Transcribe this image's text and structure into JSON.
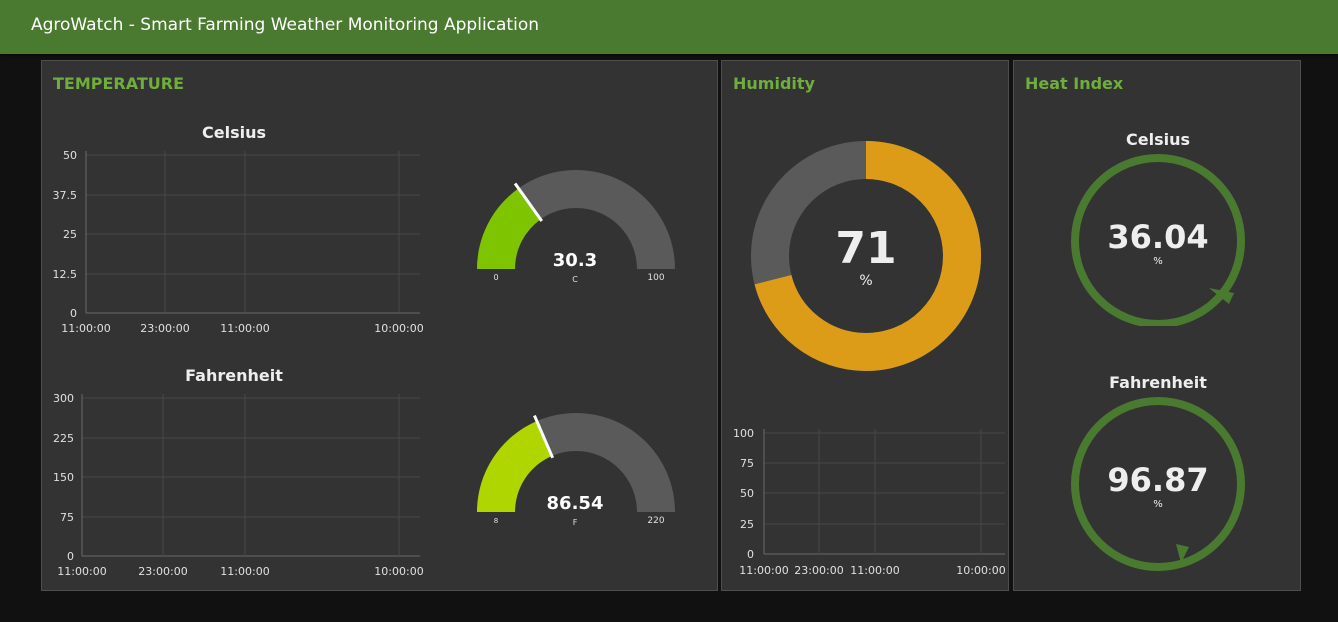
{
  "app": {
    "title": "AgroWatch - Smart Farming Weather Monitoring Application",
    "accent_color": "#4a7a2f"
  },
  "temperature": {
    "title": "TEMPERATURE",
    "celsius_chart": {
      "title": "Celsius",
      "y_ticks": [
        "50",
        "37.5",
        "25",
        "12.5",
        "0"
      ],
      "x_ticks": [
        "11:00:00",
        "23:00:00",
        "11:00:00",
        "10:00:00"
      ]
    },
    "fahrenheit_chart": {
      "title": "Fahrenheit",
      "y_ticks": [
        "300",
        "225",
        "150",
        "75",
        "0"
      ],
      "x_ticks": [
        "11:00:00",
        "23:00:00",
        "11:00:00",
        "10:00:00"
      ]
    },
    "celsius_gauge": {
      "value": 30.3,
      "value_text": "30.3",
      "unit": "C",
      "min": 0,
      "max": 100,
      "min_label": "0",
      "max_label": "100",
      "fill_color": "#7ec400"
    },
    "fahrenheit_gauge": {
      "value": 86.54,
      "value_text": "86.54",
      "unit": "F",
      "min": 8,
      "max": 220,
      "min_label": "8",
      "max_label": "220",
      "fill_color": "#b0d600"
    }
  },
  "humidity": {
    "title": "Humidity",
    "donut": {
      "value": 71,
      "value_text": "71",
      "unit": "%",
      "fill_color": "#dc9c17",
      "track_color": "#5a5a5a"
    },
    "chart": {
      "y_ticks": [
        "100",
        "75",
        "50",
        "25",
        "0"
      ],
      "x_ticks": [
        "11:00:00",
        "23:00:00",
        "11:00:00",
        "10:00:00"
      ]
    }
  },
  "heat_index": {
    "title": "Heat Index",
    "celsius": {
      "title": "Celsius",
      "value_text": "36.04",
      "unit": "%",
      "ring_color": "#4a7a2f"
    },
    "fahrenheit": {
      "title": "Fahrenheit",
      "value_text": "96.87",
      "unit": "%",
      "ring_color": "#4a7a2f"
    }
  }
}
